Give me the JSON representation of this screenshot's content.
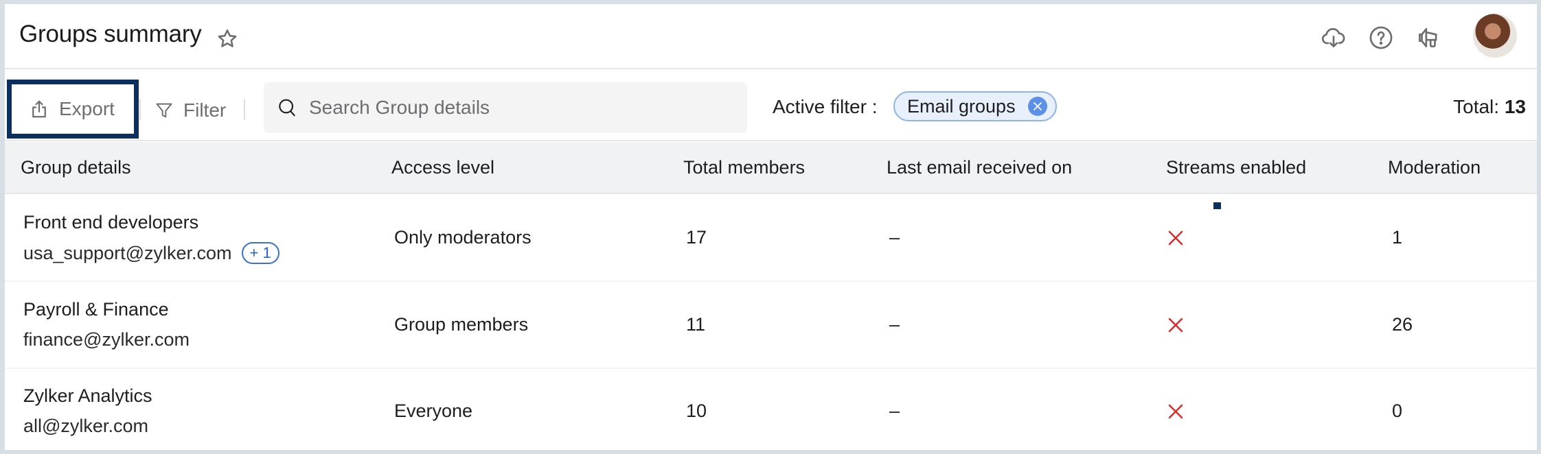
{
  "header": {
    "title": "Groups summary",
    "icons": [
      "star-icon",
      "cloud-download-icon",
      "help-icon",
      "megaphone-icon",
      "user-avatar"
    ]
  },
  "toolbar": {
    "export_label": "Export",
    "filter_label": "Filter",
    "search_placeholder": "Search Group details",
    "search_value": "",
    "active_filter_label": "Active filter :",
    "active_filter_chip": "Email groups",
    "total_label": "Total:",
    "total_value": "13"
  },
  "colors": {
    "focus_outline": "#0b305f",
    "chip_bg": "#e8f0fd",
    "chip_close": "#5c8fe6",
    "status_no": "#d32f2f"
  },
  "table": {
    "columns": [
      "Group details",
      "Access level",
      "Total members",
      "Last email received on",
      "Streams enabled",
      "Moderation"
    ],
    "rows": [
      {
        "name": "Front end developers",
        "email": "usa_support@zylker.com",
        "extra_badge": "+ 1",
        "access": "Only moderators",
        "members": "17",
        "last_email": "–",
        "streams": "disabled",
        "moderation": "1"
      },
      {
        "name": "Payroll & Finance",
        "email": "finance@zylker.com",
        "extra_badge": null,
        "access": "Group members",
        "members": "11",
        "last_email": "–",
        "streams": "disabled",
        "moderation": "26"
      },
      {
        "name": "Zylker Analytics",
        "email": "all@zylker.com",
        "extra_badge": null,
        "access": "Everyone",
        "members": "10",
        "last_email": "–",
        "streams": "disabled",
        "moderation": "0"
      }
    ]
  }
}
